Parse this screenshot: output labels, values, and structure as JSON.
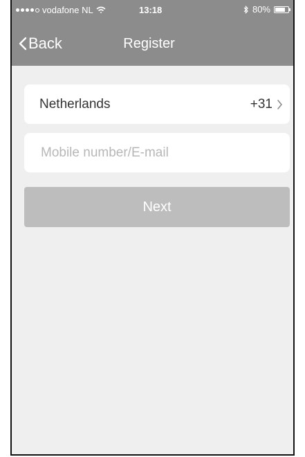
{
  "status_bar": {
    "carrier": "vodafone NL",
    "time": "13:18",
    "battery_percent": "80%",
    "battery_level": 0.8,
    "icons": [
      "signal-dots-icon",
      "wifi-icon",
      "bluetooth-icon",
      "battery-icon"
    ]
  },
  "nav": {
    "back_label": "Back",
    "title": "Register",
    "back_icon": "chevron-left-icon"
  },
  "form": {
    "country": {
      "name": "Netherlands",
      "code": "+31",
      "icon": "chevron-right-icon"
    },
    "contact": {
      "placeholder": "Mobile number/E-mail",
      "value": ""
    },
    "next_label": "Next"
  },
  "colors": {
    "header": "#8c8c8c",
    "background": "#efefef",
    "field": "#ffffff",
    "button_disabled": "#bdbdbd",
    "placeholder": "#b7b7b7"
  }
}
